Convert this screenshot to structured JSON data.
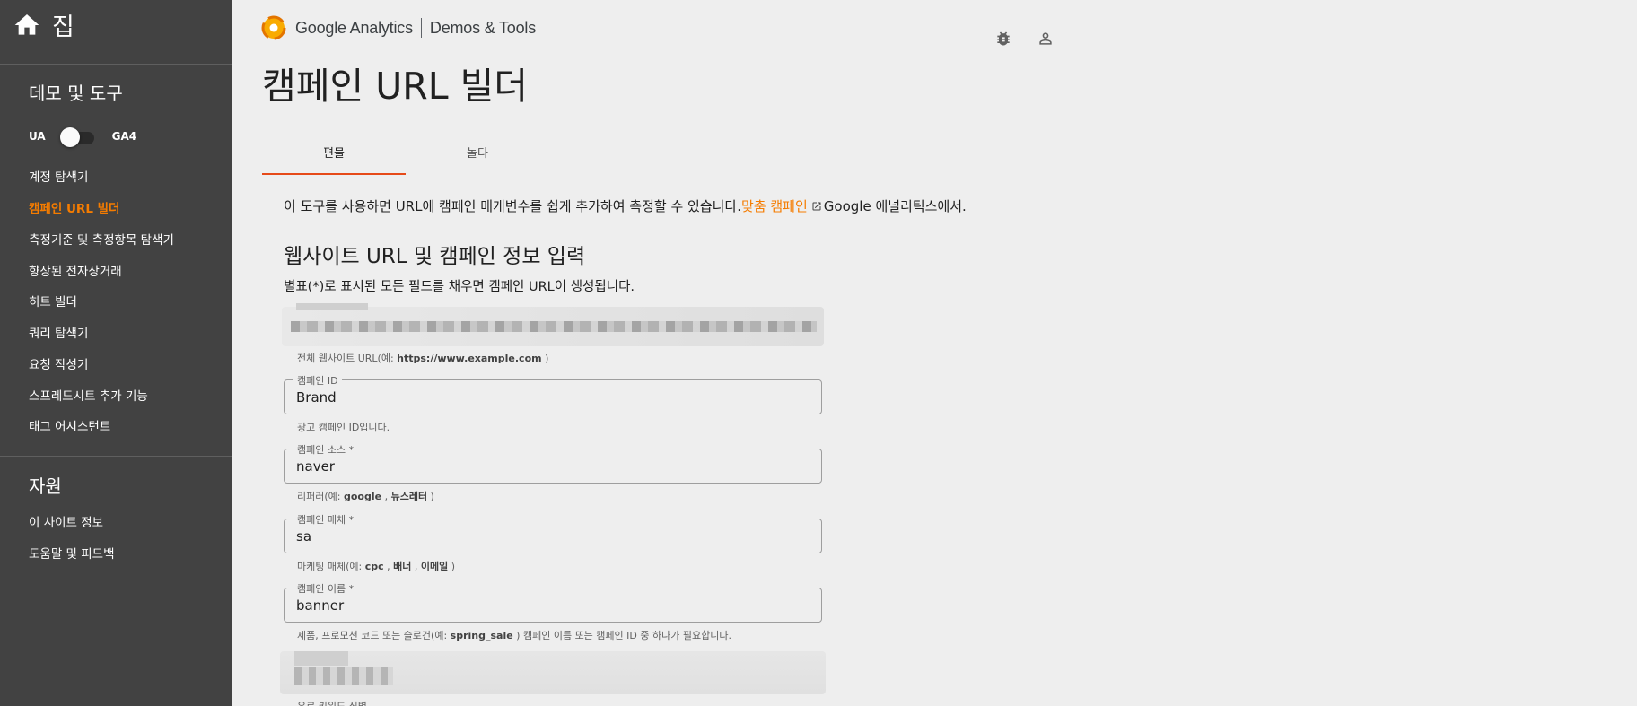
{
  "sidebar": {
    "home_label": "집",
    "section1_title": "데모 및 도구",
    "toggle": {
      "left": "UA",
      "right": "GA4"
    },
    "items": [
      {
        "label": "계정 탐색기"
      },
      {
        "label": "캠페인 URL 빌더"
      },
      {
        "label": "측정기준 및 측정항목 탐색기"
      },
      {
        "label": "향상된 전자상거래"
      },
      {
        "label": "히트 빌더"
      },
      {
        "label": "쿼리 탐색기"
      },
      {
        "label": "요청 작성기"
      },
      {
        "label": "스프레드시트 추가 기능"
      },
      {
        "label": "태그 어시스턴트"
      }
    ],
    "section2_title": "자원",
    "resources": [
      {
        "label": "이 사이트 정보"
      },
      {
        "label": "도움말 및 피드백"
      }
    ]
  },
  "header": {
    "brand_name": "Google Analytics",
    "brand_suffix": "Demos & Tools",
    "page_title": "캠페인 URL 빌더"
  },
  "tabs": [
    {
      "label": "편물"
    },
    {
      "label": "놀다"
    }
  ],
  "intro": {
    "text": "이 도구를 사용하면 URL에 캠페인 매개변수를 쉽게 추가하여 측정할 수 있습니다.",
    "link": "맞춤 캠페인",
    "suffix": "Google 애널리틱스에서."
  },
  "form": {
    "heading": "웹사이트 URL 및 캠페인 정보 입력",
    "subheading": "별표(*)로 표시된 모든 필드를 채우면 캠페인 URL이 생성됩니다.",
    "website_helper_prefix": "전체 웹사이트 URL(예: ",
    "website_helper_example": "https://www.example.com",
    "website_helper_suffix": " )",
    "campaign_id": {
      "label": "캠페인 ID",
      "value": "Brand",
      "helper": "광고 캠페인 ID입니다."
    },
    "campaign_source": {
      "label": "캠페인 소스 *",
      "value": "naver",
      "helper_prefix": "리퍼러(예: ",
      "helper_ex1": "google",
      "helper_sep": " , ",
      "helper_ex2": "뉴스레터",
      "helper_suffix": " )"
    },
    "campaign_medium": {
      "label": "캠페인 매체 *",
      "value": "sa",
      "helper_prefix": "마케팅 매체(예: ",
      "helper_ex1": "cpc",
      "helper_sep1": " , ",
      "helper_ex2": "배너",
      "helper_sep2": " , ",
      "helper_ex3": "이메일",
      "helper_suffix": " )"
    },
    "campaign_name": {
      "label": "캠페인 이름 *",
      "value": "banner",
      "helper_prefix": "제품, 프로모션 코드 또는 슬로건(예: ",
      "helper_ex1": "spring_sale",
      "helper_suffix": " ) 캠페인 이름 또는 캠페인 ID 중 하나가 필요합니다."
    },
    "paid_keyword_label": "유료 키워드 식별"
  },
  "colors": {
    "sidebar_bg": "#424242",
    "accent": "#f57c00",
    "tab_underline": "#e64a19",
    "page_bg": "#eeeeee"
  },
  "icons": [
    "home-icon",
    "analytics-logo-icon",
    "bug-icon",
    "account-icon",
    "external-link-icon"
  ]
}
